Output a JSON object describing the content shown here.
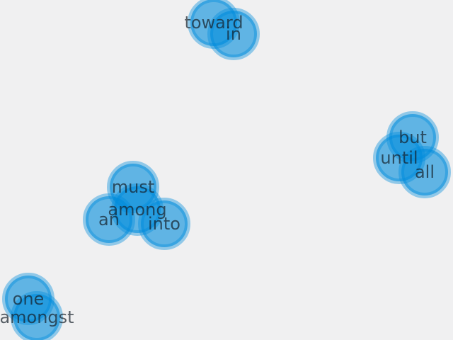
{
  "colors": {
    "background": "#f0f0f1",
    "node_fill": "#3aa0e0",
    "label_text": "#2a3440"
  },
  "nodes": [
    {
      "label": "toward"
    },
    {
      "label": "in"
    },
    {
      "label": "but"
    },
    {
      "label": "until"
    },
    {
      "label": "all"
    },
    {
      "label": "must"
    },
    {
      "label": "among"
    },
    {
      "label": "an"
    },
    {
      "label": "into"
    },
    {
      "label": "one"
    },
    {
      "label": "amongst"
    }
  ]
}
